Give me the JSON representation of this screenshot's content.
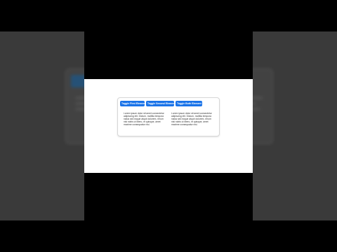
{
  "toolbar": {
    "toggle_first": "Toggle First Element",
    "toggle_second": "Toggle Second Element",
    "toggle_both": "Toggle Both Element"
  },
  "content": {
    "paragraph_left": "Lorem ipsum dolor sit amet consectetur adipiscing elit. Dictum, mollitia tempora natus sed eaque atque dolorem, rerum nisi nobis ut libero, et quisque, amet maxime consequatur nisi.",
    "paragraph_right": "Lorem ipsum dolor sit amet consectetur adipiscing elit. Dictum, mollitia tempora natus sed eaque atque dolorem, rerum nisi nobis ut libero, et quisque, amet maxime consequatur nisi."
  },
  "colors": {
    "button_bg": "#1a73e8",
    "page_bg": "#ffffff",
    "letterbox": "#000000"
  }
}
